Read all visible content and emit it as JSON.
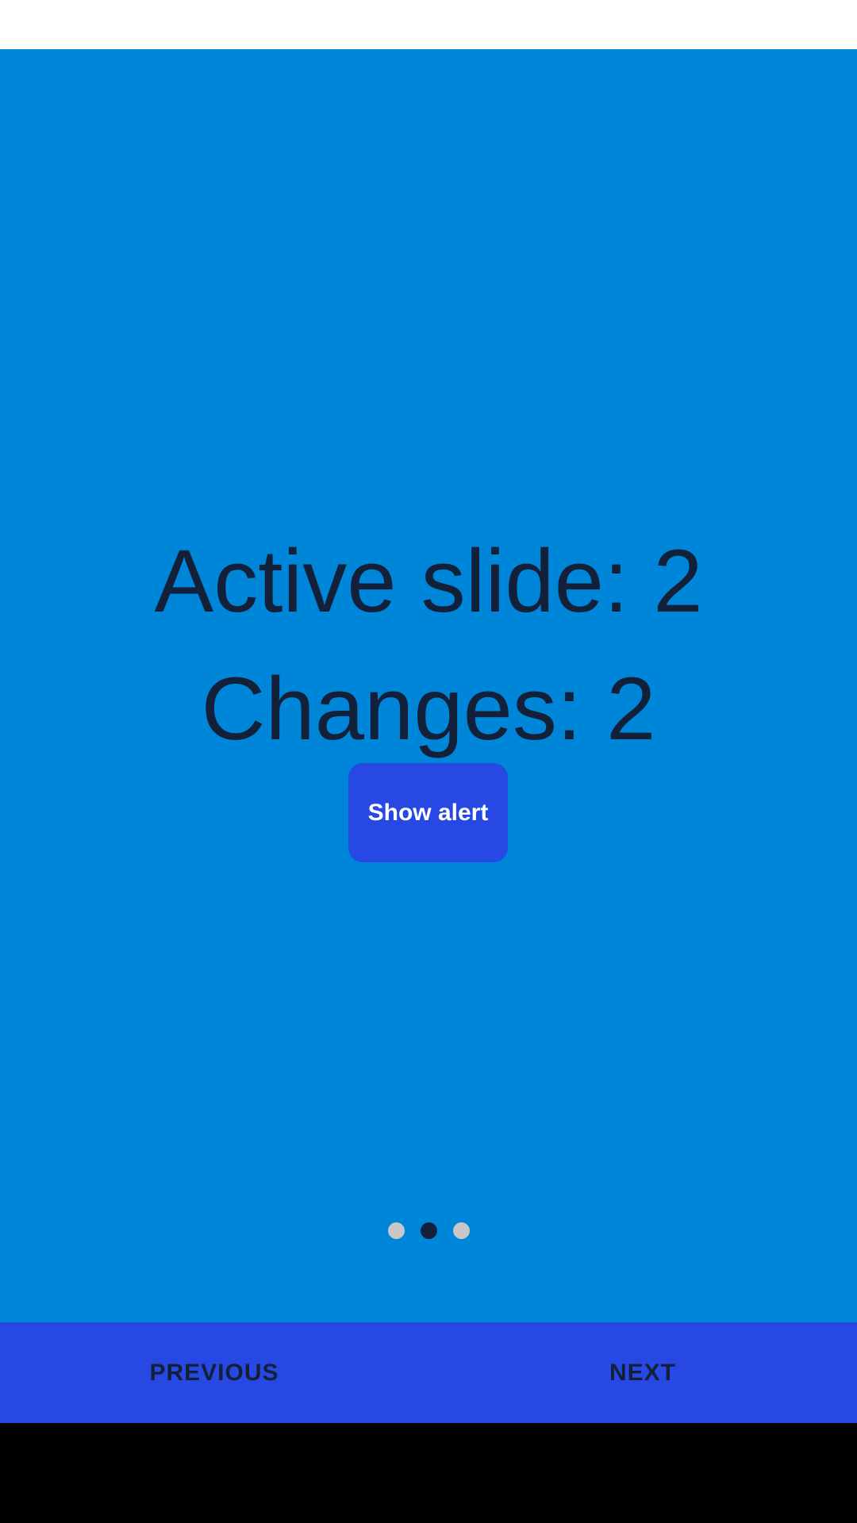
{
  "colors": {
    "slide_background": "#0086d9",
    "text_dark": "#13203a",
    "button_blue": "#2748e3",
    "dot_inactive": "#c8c8c8",
    "dot_active": "#13203a",
    "system_nav": "#000000"
  },
  "slide": {
    "active_slide_text": "Active slide: 2",
    "changes_text": "Changes: 2",
    "alert_button_label": "Show alert"
  },
  "pager": {
    "total": 3,
    "active_index": 1
  },
  "bottom_nav": {
    "previous_label": "PREVIOUS",
    "next_label": "NEXT"
  }
}
